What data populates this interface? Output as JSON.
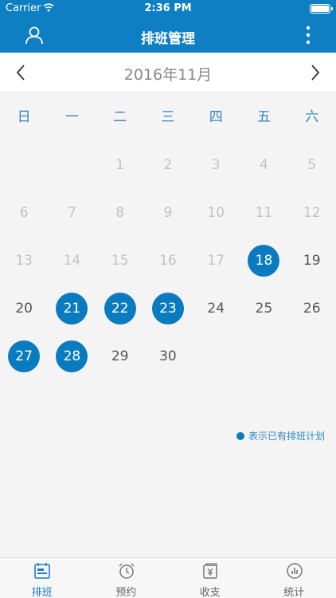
{
  "status_bar": {
    "carrier": "Carrier",
    "time": "2:36 PM"
  },
  "nav": {
    "title": "排班管理",
    "left_icon": "user-icon",
    "right_icon": "more-vertical-icon"
  },
  "calendar": {
    "month_label": "2016年11月",
    "weekdays": [
      "日",
      "一",
      "二",
      "三",
      "四",
      "五",
      "六"
    ],
    "weeks": [
      [
        null,
        null,
        {
          "day": "1",
          "state": "muted"
        },
        {
          "day": "2",
          "state": "muted"
        },
        {
          "day": "3",
          "state": "muted"
        },
        {
          "day": "4",
          "state": "muted"
        },
        {
          "day": "5",
          "state": "muted"
        }
      ],
      [
        {
          "day": "6",
          "state": "muted"
        },
        {
          "day": "7",
          "state": "muted"
        },
        {
          "day": "8",
          "state": "muted"
        },
        {
          "day": "9",
          "state": "muted"
        },
        {
          "day": "10",
          "state": "muted"
        },
        {
          "day": "11",
          "state": "muted"
        },
        {
          "day": "12",
          "state": "muted"
        }
      ],
      [
        {
          "day": "13",
          "state": "muted"
        },
        {
          "day": "14",
          "state": "muted"
        },
        {
          "day": "15",
          "state": "muted"
        },
        {
          "day": "16",
          "state": "muted"
        },
        {
          "day": "17",
          "state": "muted"
        },
        {
          "day": "18",
          "state": "scheduled"
        },
        {
          "day": "19",
          "state": "normal"
        }
      ],
      [
        {
          "day": "20",
          "state": "normal"
        },
        {
          "day": "21",
          "state": "scheduled"
        },
        {
          "day": "22",
          "state": "scheduled"
        },
        {
          "day": "23",
          "state": "scheduled"
        },
        {
          "day": "24",
          "state": "normal"
        },
        {
          "day": "25",
          "state": "normal"
        },
        {
          "day": "26",
          "state": "normal"
        }
      ],
      [
        {
          "day": "27",
          "state": "scheduled"
        },
        {
          "day": "28",
          "state": "scheduled"
        },
        {
          "day": "29",
          "state": "normal"
        },
        {
          "day": "30",
          "state": "normal"
        },
        null,
        null,
        null
      ]
    ]
  },
  "legend": {
    "text": "表示已有排班计划"
  },
  "tabs": [
    {
      "label": "排班",
      "icon": "schedule-icon",
      "active": true
    },
    {
      "label": "预约",
      "icon": "alarm-clock-icon",
      "active": false
    },
    {
      "label": "收支",
      "icon": "money-icon",
      "active": false
    },
    {
      "label": "统计",
      "icon": "stats-icon",
      "active": false
    }
  ],
  "colors": {
    "primary": "#0f7fc3",
    "scheduled": "#0b7bc0",
    "weekday_text": "#2f86c6",
    "muted_text": "#c2c2c2"
  }
}
